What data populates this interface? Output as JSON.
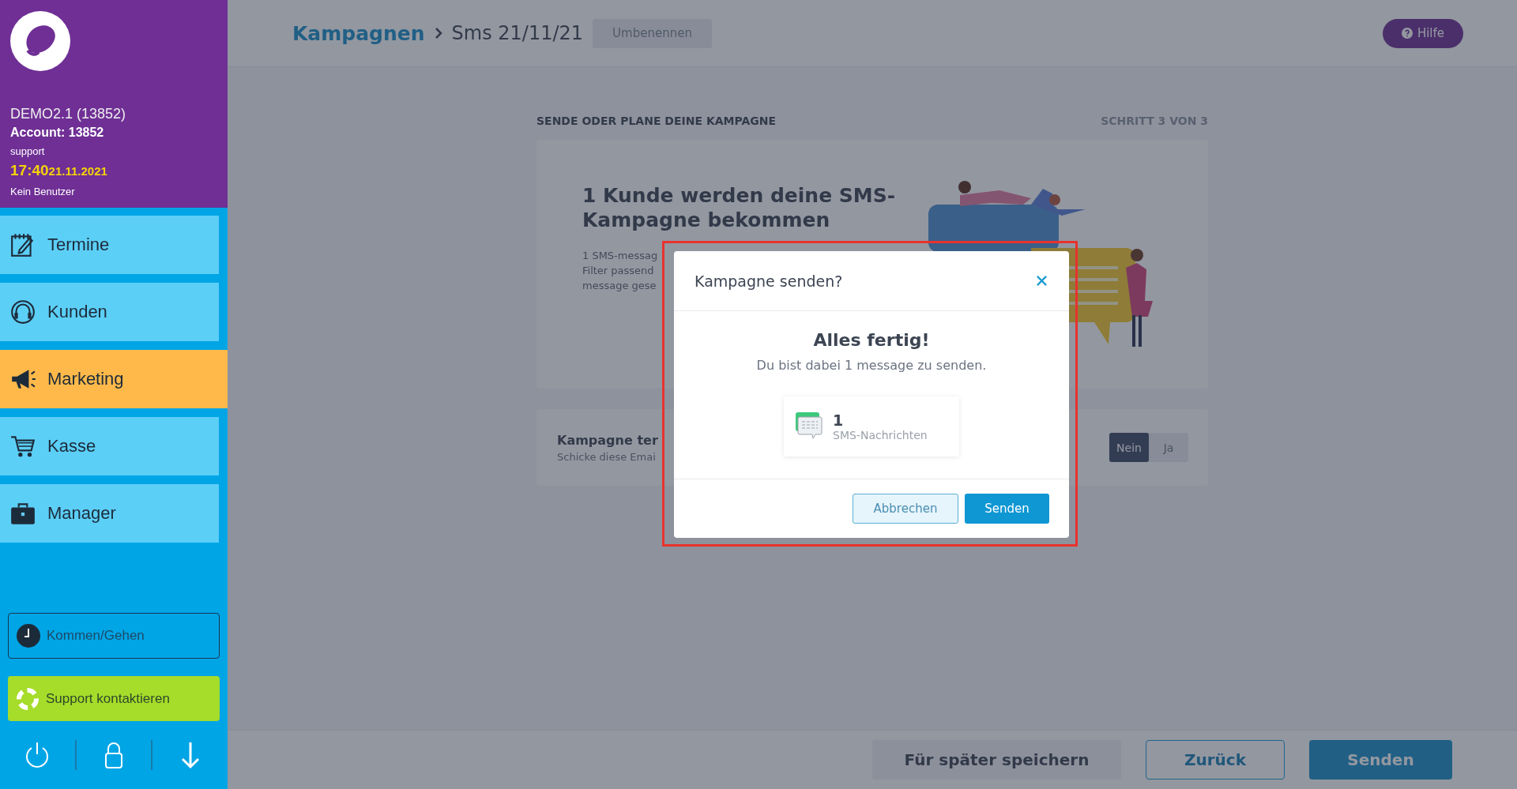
{
  "sidebar": {
    "account_name": "DEMO2.1 (13852)",
    "account": "Account: 13852",
    "user": "support",
    "time": "17:40",
    "date": "21.11.2021",
    "user_status": "Kein Benutzer",
    "nav": [
      {
        "label": "Termine",
        "selected": false
      },
      {
        "label": "Kunden",
        "selected": false
      },
      {
        "label": "Marketing",
        "selected": true
      },
      {
        "label": "Kasse",
        "selected": false
      },
      {
        "label": "Manager",
        "selected": false
      }
    ],
    "clock_button": "Kommen/Gehen",
    "support_button": "Support kontaktieren"
  },
  "header": {
    "breadcrumb": "Kampagnen",
    "title": "Sms 21/11/21",
    "rename_button": "Umbenennen",
    "help_button": "Hilfe"
  },
  "step": {
    "title": "SENDE ODER PLANE DEINE KAMPAGNE",
    "counter": "SCHRITT 3 VON 3"
  },
  "summary_card": {
    "heading": "1 Kunde werden deine SMS-Kampagne bekommen",
    "lines": [
      "1 SMS-messag",
      "Filter passend",
      "message gese"
    ]
  },
  "schedule_card": {
    "title": "Kampagne ter",
    "subtitle": "Schicke diese Emai",
    "options": [
      {
        "label": "Nein",
        "selected": true
      },
      {
        "label": "Ja",
        "selected": false
      }
    ]
  },
  "footer": {
    "buttons": [
      {
        "label": "Für später speichern",
        "kind": "secondary"
      },
      {
        "label": "Zurück",
        "kind": "outline"
      },
      {
        "label": "Senden",
        "kind": "primary"
      }
    ]
  },
  "dialog": {
    "title": "Kampagne senden?",
    "heading": "Alles fertig!",
    "message": "Du bist dabei 1 message zu senden.",
    "count": "1",
    "count_label": "SMS-Nachrichten",
    "buttons": [
      {
        "label": "Abbrechen",
        "kind": "outline"
      },
      {
        "label": "Senden",
        "kind": "primary"
      }
    ]
  }
}
